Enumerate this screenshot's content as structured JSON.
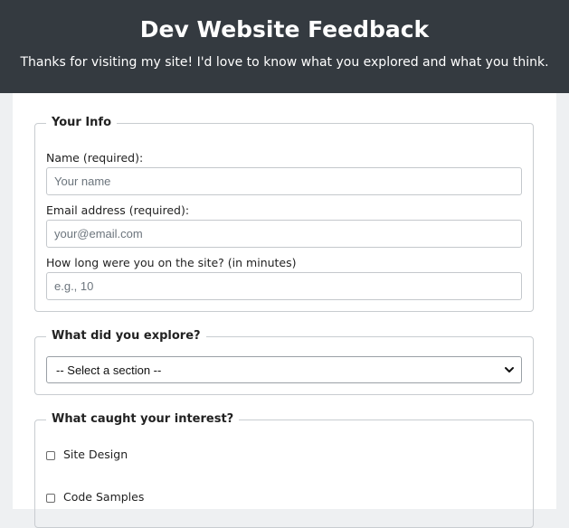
{
  "header": {
    "title": "Dev Website Feedback",
    "subtitle": "Thanks for visiting my site! I'd love to know what you explored and what you think."
  },
  "your_info": {
    "legend": "Your Info",
    "name_label": "Name (required):",
    "name_placeholder": "Your name",
    "name_value": "",
    "email_label": "Email address (required):",
    "email_placeholder": "your@email.com",
    "email_value": "",
    "time_label": "How long were you on the site? (in minutes)",
    "time_placeholder": "e.g., 10",
    "time_value": ""
  },
  "explore": {
    "legend": "What did you explore?",
    "selected": "-- Select a section --"
  },
  "interest": {
    "legend": "What caught your interest?",
    "options": [
      {
        "label": "Site Design",
        "checked": false
      },
      {
        "label": "Code Samples",
        "checked": false
      }
    ]
  },
  "colors": {
    "header_bg": "#343a40",
    "page_bg": "#eef0f2",
    "border": "#c8ccd0"
  }
}
